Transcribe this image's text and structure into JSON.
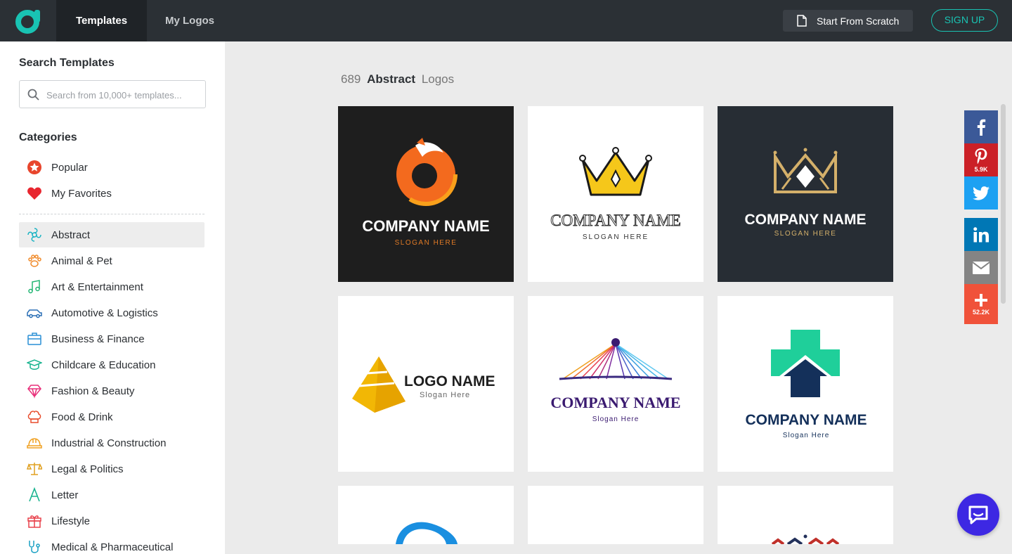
{
  "header": {
    "tabs": [
      {
        "label": "Templates",
        "active": true
      },
      {
        "label": "My Logos",
        "active": false
      }
    ],
    "start_from_scratch": "Start From Scratch",
    "sign_up": "SIGN UP",
    "accent_color": "#19c3b3"
  },
  "sidebar": {
    "search_heading": "Search Templates",
    "search_placeholder": "Search from 10,000+ templates...",
    "categories_heading": "Categories",
    "top_items": [
      {
        "label": "Popular",
        "icon": "star-badge-icon"
      },
      {
        "label": "My Favorites",
        "icon": "heart-icon"
      }
    ],
    "items": [
      {
        "label": "Abstract",
        "icon": "abstract-swirl-icon",
        "active": true
      },
      {
        "label": "Animal & Pet",
        "icon": "paw-icon"
      },
      {
        "label": "Art & Entertainment",
        "icon": "music-note-icon"
      },
      {
        "label": "Automotive & Logistics",
        "icon": "car-icon"
      },
      {
        "label": "Business & Finance",
        "icon": "briefcase-icon"
      },
      {
        "label": "Childcare & Education",
        "icon": "graduation-cap-icon"
      },
      {
        "label": "Fashion & Beauty",
        "icon": "diamond-icon"
      },
      {
        "label": "Food & Drink",
        "icon": "chef-hat-icon"
      },
      {
        "label": "Industrial & Construction",
        "icon": "hard-hat-icon"
      },
      {
        "label": "Legal & Politics",
        "icon": "scales-icon"
      },
      {
        "label": "Letter",
        "icon": "letter-a-icon"
      },
      {
        "label": "Lifestyle",
        "icon": "gift-icon"
      },
      {
        "label": "Medical & Pharmaceutical",
        "icon": "stethoscope-icon"
      }
    ]
  },
  "main": {
    "count": "689",
    "category": "Abstract",
    "suffix": "Logos",
    "templates": [
      {
        "name": "COMPANY NAME",
        "slogan": "SLOGAN HERE",
        "style": "fox-circle-dark"
      },
      {
        "name": "COMPANY NAME",
        "slogan": "SLOGAN HERE",
        "style": "yellow-crown-light"
      },
      {
        "name": "COMPANY NAME",
        "slogan": "SLOGAN HERE",
        "style": "gold-crown-dark"
      },
      {
        "name": "LOGO NAME",
        "slogan": "Slogan Here",
        "style": "yellow-pyramid"
      },
      {
        "name": "COMPANY NAME",
        "slogan": "Slogan Here",
        "style": "color-bridge"
      },
      {
        "name": "COMPANY NAME",
        "slogan": "Slogan Here",
        "style": "medical-cross-house"
      }
    ]
  },
  "social": [
    {
      "name": "facebook",
      "icon": "facebook-icon",
      "color": "#3b5998",
      "count": ""
    },
    {
      "name": "pinterest",
      "icon": "pinterest-icon",
      "color": "#cb2027",
      "count": "5.9K"
    },
    {
      "name": "twitter",
      "icon": "twitter-icon",
      "color": "#1da1f2",
      "count": ""
    },
    {
      "name": "linkedin",
      "icon": "linkedin-icon",
      "color": "#0077b5",
      "count": ""
    },
    {
      "name": "email",
      "icon": "email-icon",
      "color": "#848484",
      "count": ""
    },
    {
      "name": "share",
      "icon": "plus-icon",
      "color": "#f0523a",
      "count": "52.2K"
    }
  ]
}
